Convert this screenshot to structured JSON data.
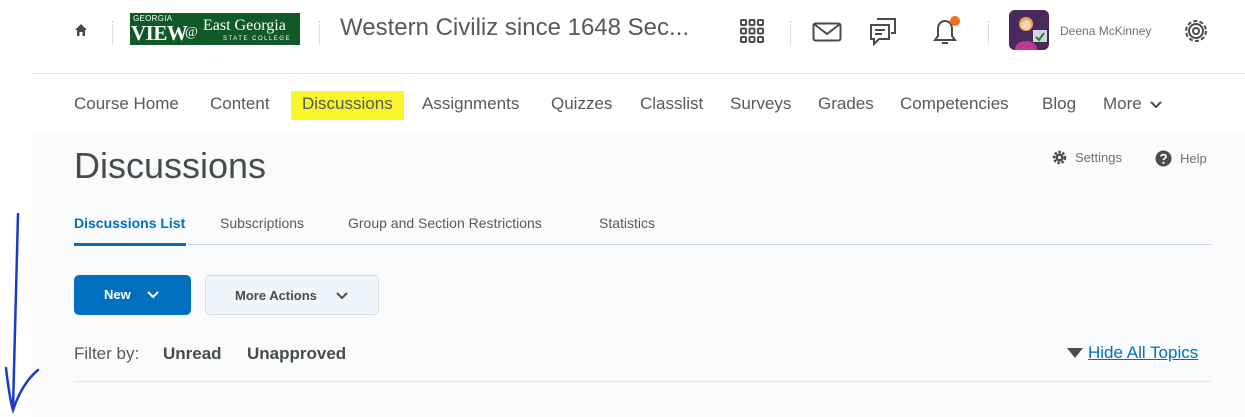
{
  "header": {
    "logo": {
      "line1": "GEORGIA",
      "line2": "VIEW",
      "at": "@",
      "line3": "East Georgia",
      "line4": "STATE COLLEGE"
    },
    "course_title": "Western Civiliz since 1648 Sec...",
    "user_name": "Deena McKinney",
    "notification_color": "#f36d21"
  },
  "nav": {
    "items": [
      "Course Home",
      "Content",
      "Discussions",
      "Assignments",
      "Quizzes",
      "Classlist",
      "Surveys",
      "Grades",
      "Competencies",
      "Blog"
    ],
    "more_label": "More",
    "highlight_color": "#f6f628"
  },
  "page": {
    "title": "Discussions",
    "settings_label": "Settings",
    "help_label": "Help"
  },
  "tabs": [
    "Discussions List",
    "Subscriptions",
    "Group and Section Restrictions",
    "Statistics"
  ],
  "buttons": {
    "new_label": "New",
    "more_actions_label": "More Actions"
  },
  "filter": {
    "label": "Filter by:",
    "options": [
      "Unread",
      "Unapproved"
    ]
  },
  "hide_all_topics": "Hide All Topics",
  "colors": {
    "accent": "#006fbf",
    "annotation": "#1a3cc9"
  }
}
